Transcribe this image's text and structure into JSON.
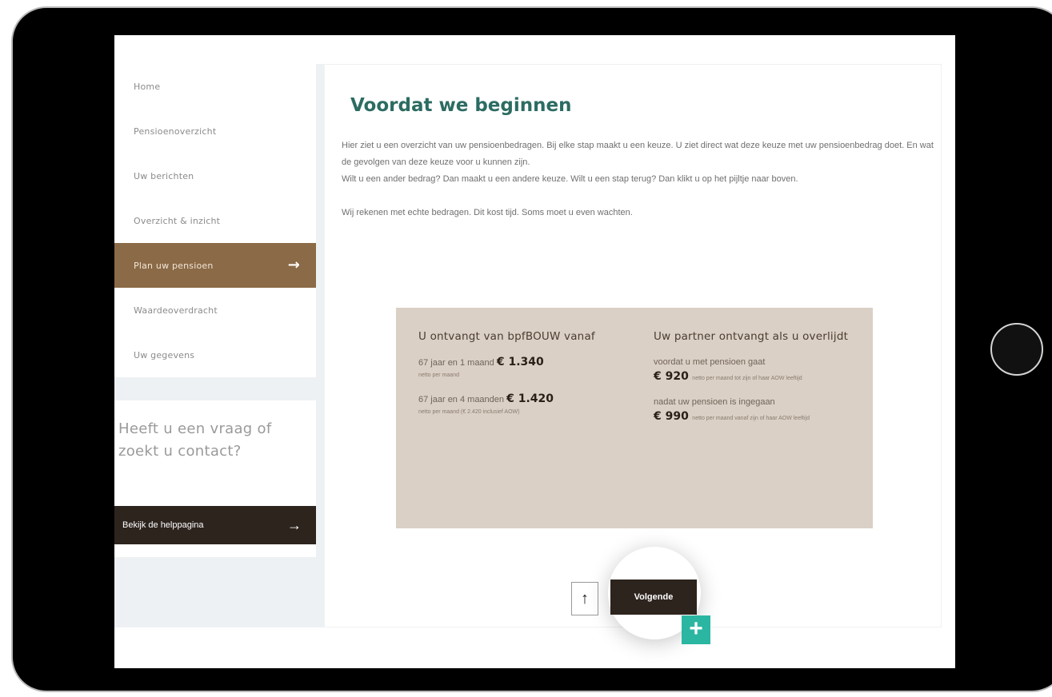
{
  "sidebar": {
    "items": [
      {
        "label": "Home"
      },
      {
        "label": "Pensioenoverzicht"
      },
      {
        "label": "Uw berichten"
      },
      {
        "label": "Overzicht & inzicht"
      },
      {
        "label": "Plan uw pensioen",
        "active": true,
        "icon": "arrow-right-icon"
      },
      {
        "label": "Waardeoverdracht"
      },
      {
        "label": "Uw gegevens"
      }
    ],
    "help_title": "Heeft u een vraag of zoekt u contact?",
    "help_button_label": "Bekijk de helppagina"
  },
  "main": {
    "title": "Voordat we beginnen",
    "intro_lines": [
      "Hier ziet u een overzicht van uw pensioenbedragen. Bij elke stap maakt u een keuze. U ziet direct wat deze keuze met uw pensioenbedrag doet. En wat de gevolgen van deze keuze voor u kunnen zijn.",
      "Wilt u een ander bedrag? Dan maakt u een andere keuze. Wilt u een stap terug? Dan klikt u op het pijltje naar boven.",
      "Wij rekenen met echte bedragen. Dit kost tijd. Soms moet u even wachten."
    ]
  },
  "card": {
    "left": {
      "title": "U ontvangt van bpfBOUW vanaf",
      "entries": [
        {
          "label": "67 jaar en 1 maand",
          "amount": "€ 1.340",
          "note": "netto per maand"
        },
        {
          "label": "67 jaar en 4 maanden",
          "amount": "€ 1.420",
          "note": "netto per maand (€ 2.420 inclusief AOW)"
        }
      ]
    },
    "right": {
      "title": "Uw partner ontvangt als u overlijdt",
      "entries": [
        {
          "label": "voordat u met pensioen gaat",
          "amount": "€ 920",
          "note": "netto per maand tot zijn of haar AOW leeftijd"
        },
        {
          "label": "nadat uw pensioen is ingegaan",
          "amount": "€ 990",
          "note": "netto per maand vanaf zijn of haar AOW leeftijd"
        }
      ]
    }
  },
  "buttons": {
    "up_icon": "arrow-up-icon",
    "up_glyph": "↑",
    "next_label": "Volgende",
    "plus_glyph": "+"
  },
  "colors": {
    "accent_green": "#2c6c62",
    "active_nav": "#8b6a47",
    "dark_button": "#2d241e",
    "card_bg": "#dad0c5",
    "badge_teal": "#2bb6a2"
  }
}
